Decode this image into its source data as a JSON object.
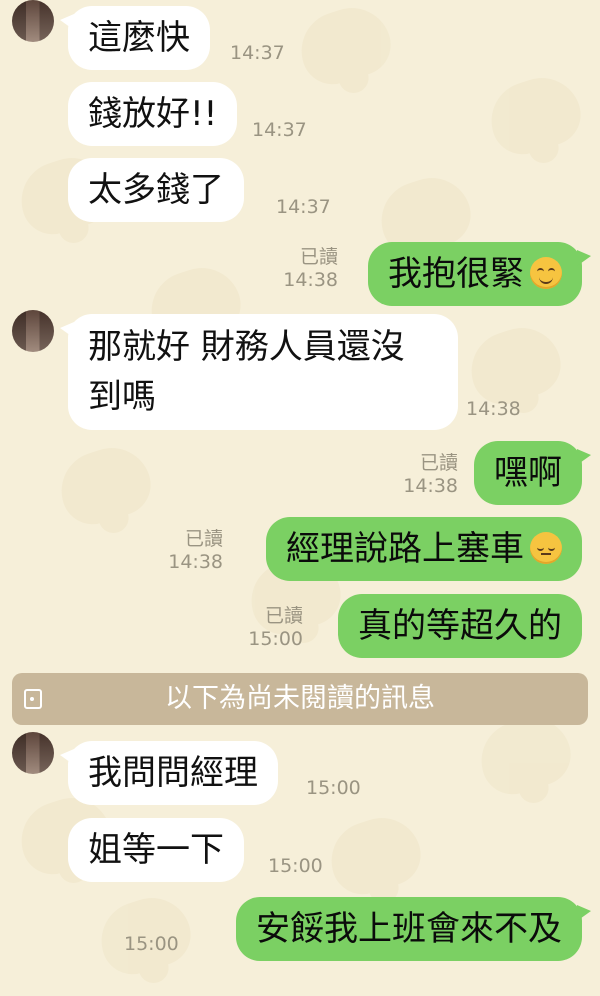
{
  "colors": {
    "background": "#f6efd9",
    "incoming_bubble": "#ffffff",
    "outgoing_bubble": "#7bd063",
    "unread_bar": "#c8b79a",
    "meta_text": "#9a9482"
  },
  "messages": [
    {
      "direction": "in",
      "text": "這麼快",
      "time": "14:37"
    },
    {
      "direction": "in",
      "text": "錢放好!!",
      "time": "14:37"
    },
    {
      "direction": "in",
      "text": "太多錢了",
      "time": "14:37"
    },
    {
      "direction": "out",
      "text": "我抱很緊",
      "emoji": "smiling-face-emoji",
      "read": "已讀",
      "time": "14:38"
    },
    {
      "direction": "in",
      "text_line1": "那就好 財務人員還沒",
      "text_line2": "到嗎",
      "time": "14:38"
    },
    {
      "direction": "out",
      "text": "嘿啊",
      "read": "已讀",
      "time": "14:38"
    },
    {
      "direction": "out",
      "text": "經理說路上塞車",
      "emoji": "pensive-face-emoji",
      "read": "已讀",
      "time": "14:38"
    },
    {
      "direction": "out",
      "text": "真的等超久的",
      "read": "已讀",
      "time": "15:00"
    },
    {
      "direction": "in",
      "text": "我問問經理",
      "time": "15:00"
    },
    {
      "direction": "in",
      "text": "姐等一下",
      "time": "15:00"
    },
    {
      "direction": "out",
      "text": "安餒我上班會來不及",
      "time": "15:00"
    }
  ],
  "unread_divider": {
    "label": "以下為尚未閱讀的訊息",
    "icon": "tag-icon"
  }
}
